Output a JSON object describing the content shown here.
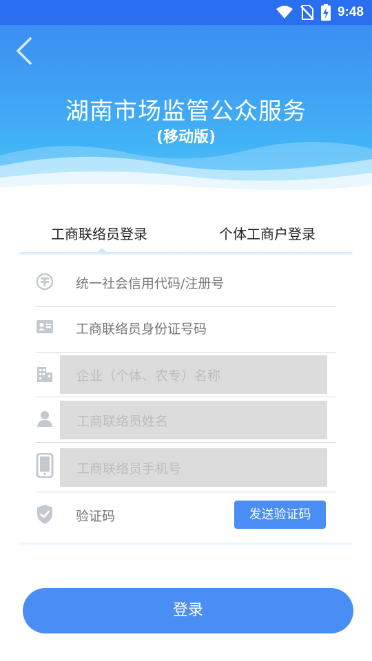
{
  "status_bar": {
    "time": "9:48",
    "icons": [
      "wifi-icon",
      "no-sim-icon",
      "battery-charging-icon"
    ]
  },
  "header": {
    "back_icon": "chevron-left-icon",
    "title": "湖南市场监管公众服务",
    "subtitle": "(移动版)"
  },
  "tabs": [
    {
      "label": "工商联络员登录",
      "active": true
    },
    {
      "label": "个体工商户登录",
      "active": false
    }
  ],
  "form": {
    "credit_code": {
      "icon": "seal-icon",
      "placeholder": "统一社会信用代码/注册号"
    },
    "id_number": {
      "icon": "id-card-icon",
      "placeholder": "工商联络员身份证号码"
    },
    "company_name": {
      "icon": "building-icon",
      "placeholder": "企业（个体、农专）名称"
    },
    "contact_name": {
      "icon": "person-icon",
      "placeholder": "工商联络员姓名"
    },
    "phone": {
      "icon": "phone-icon",
      "placeholder": "工商联络员手机号"
    },
    "verify_code": {
      "icon": "shield-check-icon",
      "placeholder": "验证码",
      "send_label": "发送验证码"
    }
  },
  "login_label": "登录",
  "colors": {
    "primary": "#4a8df5",
    "header_top": "#3b8ef2",
    "header_bottom": "#5ac6f8",
    "disabled_field": "#dcdcdc"
  }
}
